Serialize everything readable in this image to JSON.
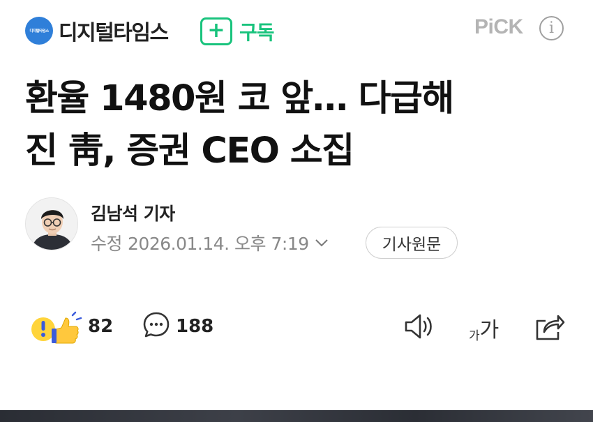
{
  "header": {
    "logo_text": "디지털타임스",
    "brand_name": "디지털타임스",
    "subscribe_label": "구독",
    "pick_label": "PiCK",
    "info_glyph": "i"
  },
  "article": {
    "title_line1": "환율 1480원 코 앞… 다급해",
    "title_line2": "진 靑, 증권 CEO 소집",
    "reporter": "김남석 기자",
    "date_label": "수정",
    "date_value": "2026.01.14. 오후 7:19",
    "original_button": "기사원문"
  },
  "actions": {
    "reaction_count": "82",
    "comment_count": "188",
    "font_small": "가",
    "font_big": "가"
  },
  "colors": {
    "accent_green": "#19c37d",
    "brand_blue": "#2f7fd9",
    "muted_gray": "#888888"
  },
  "icons": [
    "reaction-icons",
    "comment-icon",
    "speaker-icon",
    "font-size-icon",
    "share-icon",
    "info-icon",
    "chevron-down-icon"
  ]
}
